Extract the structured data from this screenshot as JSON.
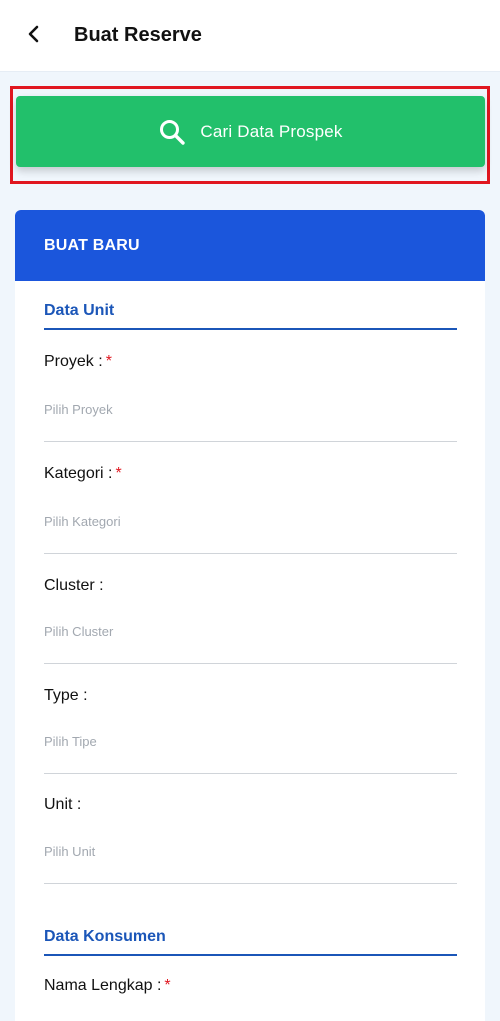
{
  "header": {
    "back_icon": "chevron-left-icon",
    "title": "Buat Reserve"
  },
  "search": {
    "icon": "search-icon",
    "label": "Cari Data Prospek",
    "button_color": "#22c06b",
    "highlight_color": "#e0161f"
  },
  "form": {
    "header": "BUAT BARU",
    "header_color": "#1b56dc",
    "sections": {
      "unit": "Data Unit",
      "consumer": "Data Konsumen"
    },
    "fields": {
      "proyek": {
        "label": "Proyek :",
        "required": "*",
        "placeholder": "Pilih Proyek"
      },
      "kategori": {
        "label": "Kategori :",
        "required": "*",
        "placeholder": "Pilih Kategori"
      },
      "cluster": {
        "label": "Cluster :",
        "placeholder": "Pilih Cluster"
      },
      "type": {
        "label": "Type :",
        "placeholder": "Pilih Tipe"
      },
      "unit": {
        "label": "Unit :",
        "placeholder": "Pilih Unit"
      },
      "nama": {
        "label": "Nama Lengkap :",
        "required": "*"
      }
    }
  }
}
